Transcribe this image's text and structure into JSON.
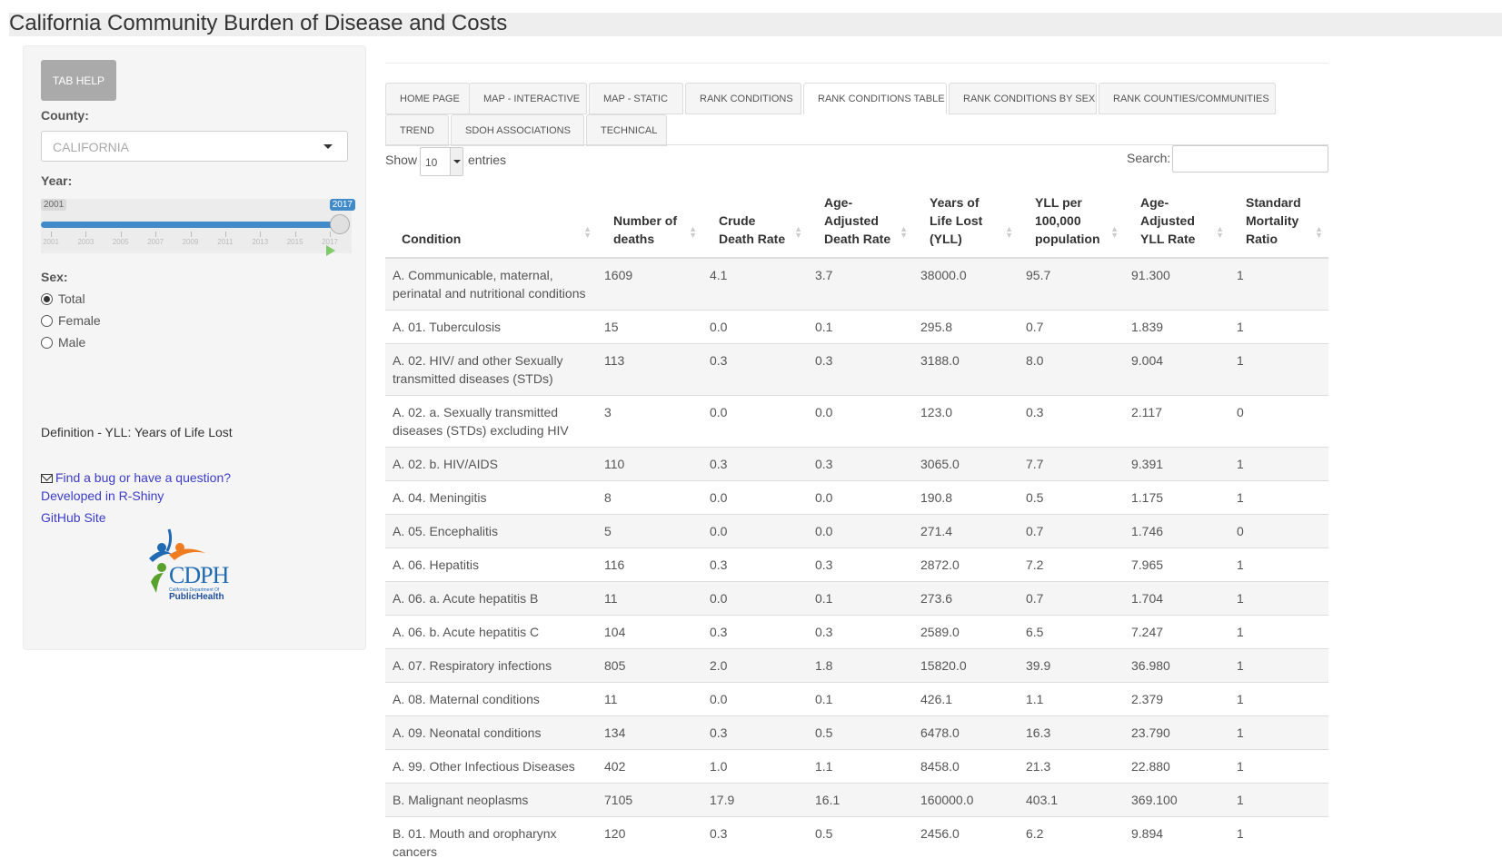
{
  "app": {
    "title": "California Community Burden of Disease and Costs"
  },
  "sidebar": {
    "tab_help": "TAB HELP",
    "county_label": "County:",
    "county_value": "CALIFORNIA",
    "year_label": "Year:",
    "year_min": "2001",
    "year_max": "2017",
    "year_ticks": [
      "2001",
      "2003",
      "2005",
      "2007",
      "2009",
      "2011",
      "2013",
      "2015",
      "2017"
    ],
    "sex_label": "Sex:",
    "sex_options": [
      "Total",
      "Female",
      "Male"
    ],
    "sex_selected": "Total",
    "definition": "Definition - YLL: Years of Life Lost",
    "bug_link": "Find a bug or have a question?",
    "rshiny_link": "Developed in R-Shiny",
    "github_link": "GitHub Site",
    "logo": {
      "letters": "CDPH",
      "sub1": "California Department Of",
      "sub2": "PublicHealth"
    }
  },
  "tabs": [
    "HOME PAGE",
    "MAP - INTERACTIVE",
    "MAP - STATIC",
    "RANK CONDITIONS",
    "RANK CONDITIONS TABLE",
    "RANK CONDITIONS BY SEX",
    "RANK COUNTIES/COMMUNITIES",
    "TREND",
    "SDOH ASSOCIATIONS",
    "TECHNICAL"
  ],
  "active_tab": "RANK CONDITIONS TABLE",
  "table_controls": {
    "show": "Show",
    "entries_value": "10",
    "entries": "entries",
    "search": "Search:"
  },
  "table": {
    "headers": [
      "Condition",
      "Number of deaths",
      "Crude Death Rate",
      "Age-Adjusted Death Rate",
      "Years of Life Lost (YLL)",
      "YLL per 100,000 population",
      "Age-Adjusted YLL Rate",
      "Standard Mortality Ratio"
    ],
    "rows": [
      [
        "A. Communicable, maternal, perinatal and nutritional conditions",
        "1609",
        "4.1",
        "3.7",
        "38000.0",
        "95.7",
        "91.300",
        "1"
      ],
      [
        "A. 01. Tuberculosis",
        "15",
        "0.0",
        "0.1",
        "295.8",
        "0.7",
        "1.839",
        "1"
      ],
      [
        "A. 02. HIV/ and other Sexually transmitted diseases (STDs)",
        "113",
        "0.3",
        "0.3",
        "3188.0",
        "8.0",
        "9.004",
        "1"
      ],
      [
        "A. 02. a. Sexually transmitted diseases (STDs) excluding HIV",
        "3",
        "0.0",
        "0.0",
        "123.0",
        "0.3",
        "2.117",
        "0"
      ],
      [
        "A. 02. b. HIV/AIDS",
        "110",
        "0.3",
        "0.3",
        "3065.0",
        "7.7",
        "9.391",
        "1"
      ],
      [
        "A. 04. Meningitis",
        "8",
        "0.0",
        "0.0",
        "190.8",
        "0.5",
        "1.175",
        "1"
      ],
      [
        "A. 05. Encephalitis",
        "5",
        "0.0",
        "0.0",
        "271.4",
        "0.7",
        "1.746",
        "0"
      ],
      [
        "A. 06. Hepatitis",
        "116",
        "0.3",
        "0.3",
        "2872.0",
        "7.2",
        "7.965",
        "1"
      ],
      [
        "A. 06. a. Acute hepatitis B",
        "11",
        "0.0",
        "0.1",
        "273.6",
        "0.7",
        "1.704",
        "1"
      ],
      [
        "A. 06. b. Acute hepatitis C",
        "104",
        "0.3",
        "0.3",
        "2589.0",
        "6.5",
        "7.247",
        "1"
      ],
      [
        "A. 07. Respiratory infections",
        "805",
        "2.0",
        "1.8",
        "15820.0",
        "39.9",
        "36.980",
        "1"
      ],
      [
        "A. 08. Maternal conditions",
        "11",
        "0.0",
        "0.1",
        "426.1",
        "1.1",
        "2.379",
        "1"
      ],
      [
        "A. 09. Neonatal conditions",
        "134",
        "0.3",
        "0.5",
        "6478.0",
        "16.3",
        "23.790",
        "1"
      ],
      [
        "A. 99. Other Infectious Diseases",
        "402",
        "1.0",
        "1.1",
        "8458.0",
        "21.3",
        "22.880",
        "1"
      ],
      [
        "B. Malignant neoplasms",
        "7105",
        "17.9",
        "16.1",
        "160000.0",
        "403.1",
        "369.100",
        "1"
      ],
      [
        "B. 01. Mouth and oropharynx cancers",
        "120",
        "0.3",
        "0.5",
        "2456.0",
        "6.2",
        "9.894",
        "1"
      ]
    ]
  }
}
